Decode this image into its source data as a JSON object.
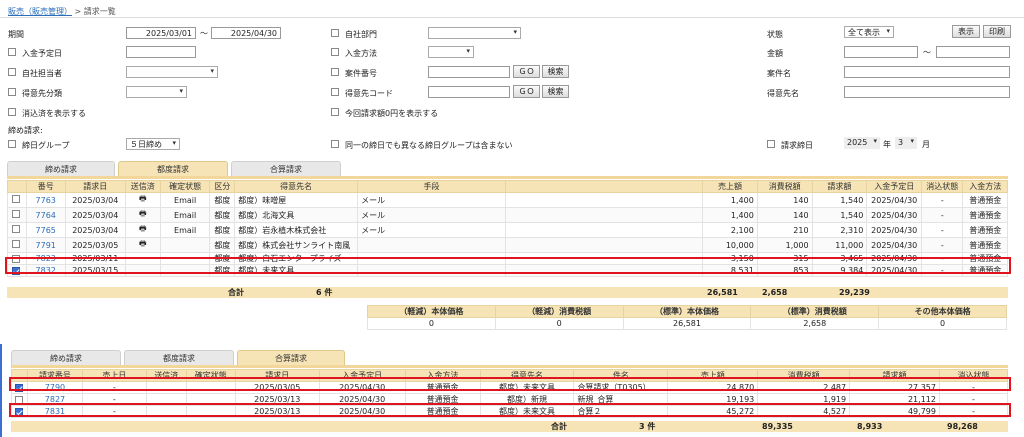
{
  "breadcrumb": {
    "root": "販売（販売管理）",
    "sep": ">",
    "current": "請求一覧"
  },
  "filters": {
    "period_label": "期間",
    "period_from": "2025/03/01",
    "tilde": "～",
    "period_to": "2025/04/30",
    "payment_due_label": "入金予定日",
    "own_rep_label": "自社担当者",
    "cust_class_label": "得意先分類",
    "show_settled_label": "消込済を表示する",
    "own_dept_label": "自社部門",
    "pay_method_label": "入金方法",
    "case_no_label": "案件番号",
    "cust_code_label": "得意先コード",
    "zero_label": "今回請求額0円を表示する",
    "go": "ＧＯ",
    "search": "検索",
    "status_label": "状態",
    "status_value": "全て表示",
    "show_btn": "表示",
    "print_btn": "印刷",
    "amount_label": "金額",
    "case_name_label": "案件名",
    "cust_name_label": "得意先名",
    "closing_label": "締め請求:",
    "closing_group_label": "締日グループ",
    "closing_group_value": "５日締め",
    "same_day_label": "同一の締日でも異なる締日グループは含まない",
    "bill_close_label": "請求締日",
    "year_value": "2025",
    "year_unit": "年",
    "month_value": "3",
    "month_unit": "月"
  },
  "tabs1": [
    "締め請求",
    "都度請求",
    "合算請求"
  ],
  "table1": {
    "headers": [
      "",
      "番号",
      "請求日",
      "送信済",
      "確定状態",
      "区分",
      "得意先名",
      "手段",
      "",
      "売上額",
      "消費税額",
      "請求額",
      "入金予定日",
      "消込状態",
      "入金方法"
    ],
    "rows": [
      {
        "no": "7763",
        "date": "2025/03/04",
        "sent": "🖶",
        "status": "Email",
        "kbn": "都度",
        "name": "都度）味噌屋",
        "means": "メール",
        "sales": "1,400",
        "tax": "140",
        "bill": "1,540",
        "due": "2025/04/30",
        "settle": "-",
        "method": "普通預金",
        "checked": false
      },
      {
        "no": "7764",
        "date": "2025/03/04",
        "sent": "🖶",
        "status": "Email",
        "kbn": "都度",
        "name": "都度）北海文具",
        "means": "メール",
        "sales": "1,400",
        "tax": "140",
        "bill": "1,540",
        "due": "2025/04/30",
        "settle": "-",
        "method": "普通預金",
        "checked": false
      },
      {
        "no": "7765",
        "date": "2025/03/04",
        "sent": "🖶",
        "status": "Email",
        "kbn": "都度",
        "name": "都度）岩永植木株式会社",
        "means": "メール",
        "sales": "2,100",
        "tax": "210",
        "bill": "2,310",
        "due": "2025/04/30",
        "settle": "-",
        "method": "普通預金",
        "checked": false
      },
      {
        "no": "7791",
        "date": "2025/03/05",
        "sent": "🖶",
        "status": "",
        "kbn": "都度",
        "name": "都度）株式会社サンライト南風",
        "means": "",
        "sales": "10,000",
        "tax": "1,000",
        "bill": "11,000",
        "due": "2025/04/30",
        "settle": "-",
        "method": "普通預金",
        "checked": false
      },
      {
        "no": "7823",
        "date": "2025/03/11",
        "sent": "",
        "status": "",
        "kbn": "都度",
        "name": "都度）白石エンタープライズ",
        "means": "",
        "sales": "3,150",
        "tax": "315",
        "bill": "3,465",
        "due": "2025/04/30",
        "settle": "-",
        "method": "普通預金",
        "checked": false
      },
      {
        "no": "7832",
        "date": "2025/03/15",
        "sent": "",
        "status": "",
        "kbn": "都度",
        "name": "都度）未来文具",
        "means": "",
        "sales": "8,531",
        "tax": "853",
        "bill": "9,384",
        "due": "2025/04/30",
        "settle": "-",
        "method": "普通預金",
        "checked": true
      }
    ],
    "sum_label": "合計",
    "count": "6 件",
    "sum_sales": "26,581",
    "sum_tax": "2,658",
    "sum_bill": "29,239"
  },
  "breakdown": {
    "headers": [
      "（軽減）本体価格",
      "（軽減）消費税額",
      "（標準）本体価格",
      "（標準）消費税額",
      "その他本体価格"
    ],
    "values": [
      "0",
      "0",
      "26,581",
      "2,658",
      "0"
    ]
  },
  "tabs2": [
    "締め請求",
    "都度請求",
    "合算請求"
  ],
  "table2": {
    "headers": [
      "",
      "請求番号",
      "売上日",
      "送信済",
      "確定状態",
      "請求日",
      "入金予定日",
      "入金方法",
      "得意先名",
      "件名",
      "売上額",
      "消費税額",
      "請求額",
      "消込状態"
    ],
    "rows": [
      {
        "no": "7790",
        "sale": "-",
        "date": "2025/03/05",
        "due": "2025/04/30",
        "method": "普通預金",
        "name": "都度）未来文具",
        "subject": "合算請求（T0305）",
        "sales": "24,870",
        "tax": "2,487",
        "bill": "27,357",
        "settle": "-",
        "checked": true
      },
      {
        "no": "7827",
        "sale": "-",
        "date": "2025/03/13",
        "due": "2025/04/30",
        "method": "普通預金",
        "name": "都度）新規",
        "subject": "新規_合算",
        "sales": "19,193",
        "tax": "1,919",
        "bill": "21,112",
        "settle": "-",
        "checked": false
      },
      {
        "no": "7831",
        "sale": "-",
        "date": "2025/03/13",
        "due": "2025/04/30",
        "method": "普通預金",
        "name": "都度）未来文具",
        "subject": "合算２",
        "sales": "45,272",
        "tax": "4,527",
        "bill": "49,799",
        "settle": "-",
        "checked": true
      }
    ],
    "sum_label": "合計",
    "count": "3 件",
    "sum_sales": "89,335",
    "sum_tax": "8,933",
    "sum_bill": "98,268"
  },
  "colors": {
    "accent": "#f6e4b6",
    "highlight": "#e0141e",
    "link": "#2a6db8"
  }
}
